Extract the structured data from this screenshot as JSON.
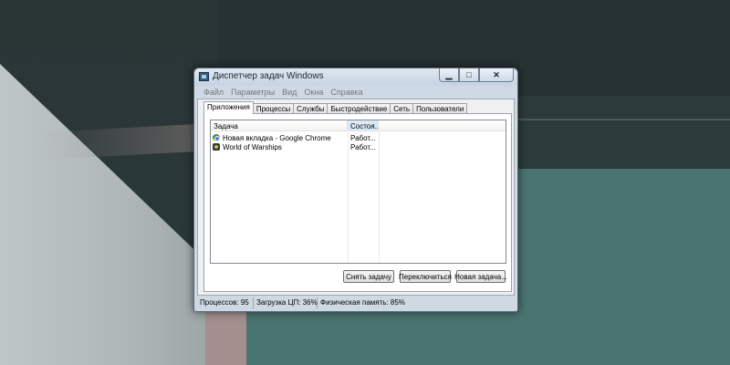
{
  "window": {
    "title": "Диспетчер задач Windows",
    "controls": {
      "minimize": "▁",
      "maximize": "□",
      "close": "✕"
    },
    "icon": "task-manager-icon"
  },
  "menu": [
    "Файл",
    "Параметры",
    "Вид",
    "Окна",
    "Справка"
  ],
  "tabs": [
    {
      "label": "Приложения",
      "active": true
    },
    {
      "label": "Процессы",
      "active": false
    },
    {
      "label": "Службы",
      "active": false
    },
    {
      "label": "Быстродействие",
      "active": false
    },
    {
      "label": "Сеть",
      "active": false
    },
    {
      "label": "Пользователи",
      "active": false
    }
  ],
  "table": {
    "columns": [
      "Задача",
      "Состоя..."
    ],
    "rows": [
      {
        "task": "Новая вкладка - Google Chrome",
        "status": "Работ...",
        "icon": "chrome-icon"
      },
      {
        "task": "World of Warships",
        "status": "Работ...",
        "icon": "world-of-warships-icon"
      }
    ]
  },
  "buttons": {
    "end_task": "Снять задачу",
    "switch_to": "Переключиться",
    "new_task": "Новая задача..."
  },
  "statusbar": {
    "processes": "Процессов: 95",
    "cpu": "Загрузка ЦП: 36%",
    "memory": "Физическая память: 85%"
  }
}
